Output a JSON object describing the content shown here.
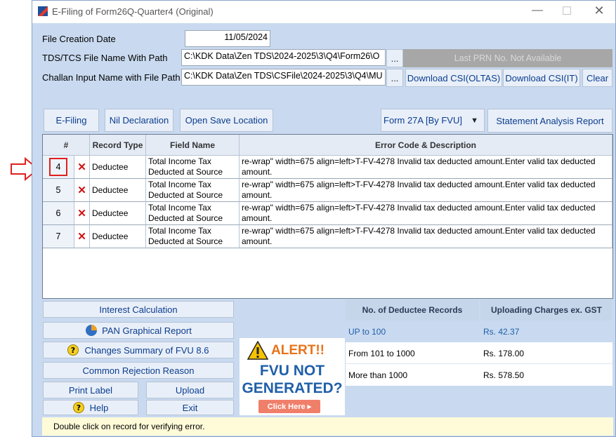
{
  "window": {
    "title": "E-Filing of Form26Q-Quarter4 (Original)"
  },
  "form": {
    "file_creation_date_label": "File Creation Date",
    "file_creation_date": "11/05/2024",
    "tds_file_label": "TDS/TCS File Name With Path",
    "tds_file_path": "C:\\KDK Data\\Zen TDS\\2024-2025\\3\\Q4\\Form26\\O",
    "challan_label": "Challan Input Name with File Path",
    "challan_path": "C:\\KDK Data\\Zen TDS\\CSFile\\2024-2025\\3\\Q4\\MU",
    "browse_label": "...",
    "prn_status": "Last PRN No. Not Available",
    "download_oltas": "Download CSI(OLTAS)",
    "download_it": "Download CSI(IT)",
    "clear": "Clear"
  },
  "toolbar": {
    "efiling": "E-Filing",
    "nil_declaration": "Nil Declaration",
    "open_save_location": "Open Save Location",
    "form_select": "Form 27A [By FVU]",
    "statement_analysis": "Statement Analysis Report"
  },
  "grid": {
    "headers": [
      "#",
      "Record Type",
      "Field Name",
      "Error Code & Description"
    ],
    "rows": [
      {
        "num": "4",
        "type": "Deductee",
        "field": "Total Income Tax Deducted at Source",
        "error": "re-wrap\" width=675 align=left>T-FV-4278 Invalid tax deducted amount.Enter valid tax deducted amount."
      },
      {
        "num": "5",
        "type": "Deductee",
        "field": "Total Income Tax Deducted at Source",
        "error": "re-wrap\" width=675 align=left>T-FV-4278 Invalid tax deducted amount.Enter valid tax deducted amount."
      },
      {
        "num": "6",
        "type": "Deductee",
        "field": "Total Income Tax Deducted at Source",
        "error": "re-wrap\" width=675 align=left>T-FV-4278 Invalid tax deducted amount.Enter valid tax deducted amount."
      },
      {
        "num": "7",
        "type": "Deductee",
        "field": "Total Income Tax Deducted at Source",
        "error": "re-wrap\" width=675 align=left>T-FV-4278 Invalid tax deducted amount.Enter valid tax deducted amount."
      }
    ]
  },
  "actions": {
    "interest_calculation": "Interest Calculation",
    "pan_graphical_report": "PAN Graphical Report",
    "changes_summary": "Changes Summary of FVU 8.6",
    "common_rejection": "Common Rejection Reason",
    "print_label": "Print Label",
    "upload": "Upload",
    "help": "Help",
    "exit": "Exit"
  },
  "alert": {
    "title": "ALERT!!",
    "line1": "FVU NOT",
    "line2": "GENERATED?",
    "cta": "Click Here ▸"
  },
  "fees": {
    "col1": "No. of Deductee Records",
    "col2": "Uploading Charges ex. GST",
    "rows": [
      {
        "range": "UP to 100",
        "charge": "Rs. 42.37"
      },
      {
        "range": "From 101 to 1000",
        "charge": "Rs. 178.00"
      },
      {
        "range": "More than 1000",
        "charge": "Rs. 578.50"
      }
    ]
  },
  "status": {
    "hint": "Double click on record for verifying error."
  },
  "colors": {
    "accent": "#0a3d8f",
    "error_red": "#d01010",
    "alert_orange": "#e8731a",
    "alert_blue": "#1f5fa8",
    "window_bg": "#c9daf0"
  }
}
